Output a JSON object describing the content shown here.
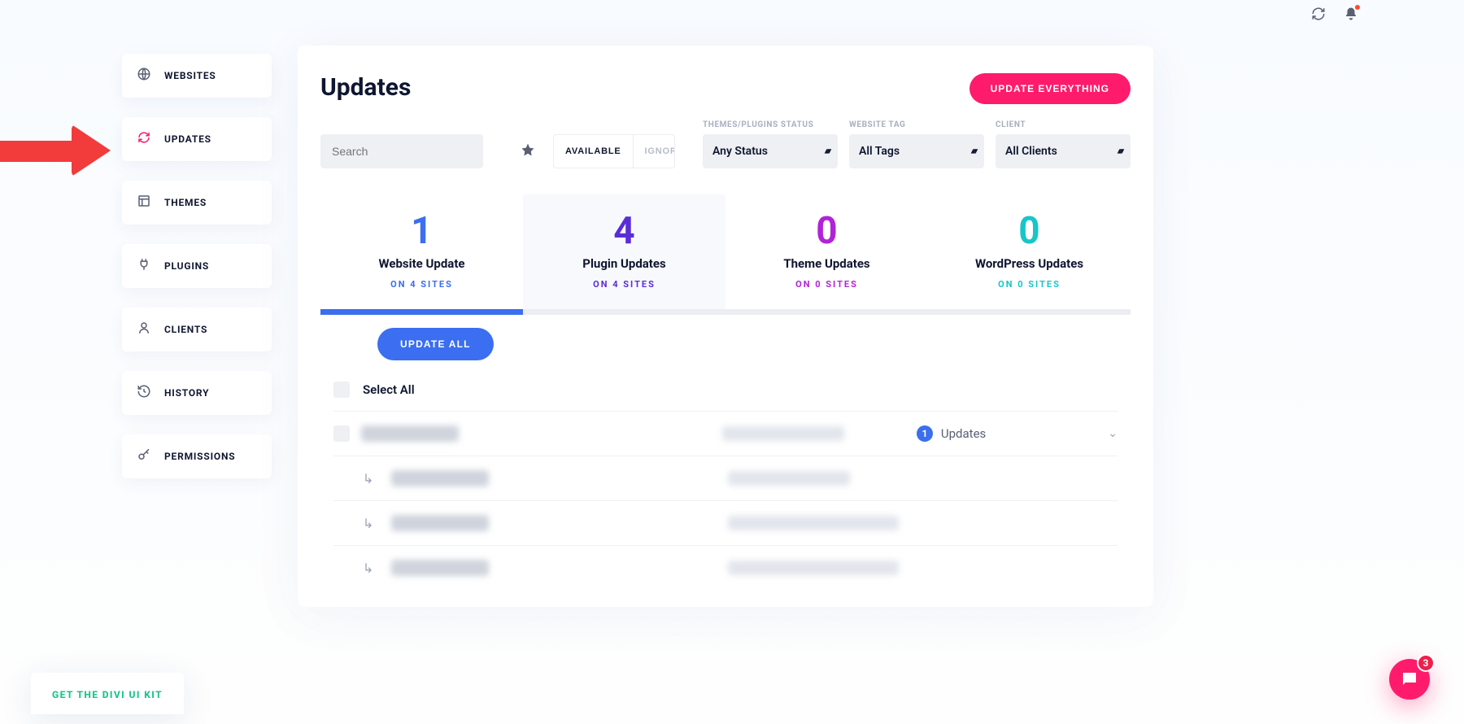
{
  "topbar": {},
  "sidebar": {
    "items": [
      {
        "label": "WEBSITES"
      },
      {
        "label": "UPDATES"
      },
      {
        "label": "THEMES"
      },
      {
        "label": "PLUGINS"
      },
      {
        "label": "CLIENTS"
      },
      {
        "label": "HISTORY"
      },
      {
        "label": "PERMISSIONS"
      }
    ]
  },
  "header": {
    "title": "Updates",
    "cta": "UPDATE EVERYTHING"
  },
  "filters": {
    "search_placeholder": "Search",
    "seg_available": "AVAILABLE",
    "seg_ignored": "IGNORED",
    "status_label": "THEMES/PLUGINS STATUS",
    "status_value": "Any Status",
    "tag_label": "WEBSITE TAG",
    "tag_value": "All Tags",
    "client_label": "CLIENT",
    "client_value": "All Clients"
  },
  "stats": [
    {
      "count": "1",
      "title": "Website Update",
      "sub": "ON 4 SITES"
    },
    {
      "count": "4",
      "title": "Plugin Updates",
      "sub": "ON 4 SITES"
    },
    {
      "count": "0",
      "title": "Theme Updates",
      "sub": "ON 0 SITES"
    },
    {
      "count": "0",
      "title": "WordPress Updates",
      "sub": "ON 0 SITES"
    }
  ],
  "actions": {
    "update_all": "UPDATE ALL",
    "select_all": "Select All"
  },
  "list": {
    "main_badge": "1",
    "main_label": "Updates"
  },
  "promo": {
    "text": "GET THE DIVI UI KIT"
  },
  "chat": {
    "count": "3"
  }
}
